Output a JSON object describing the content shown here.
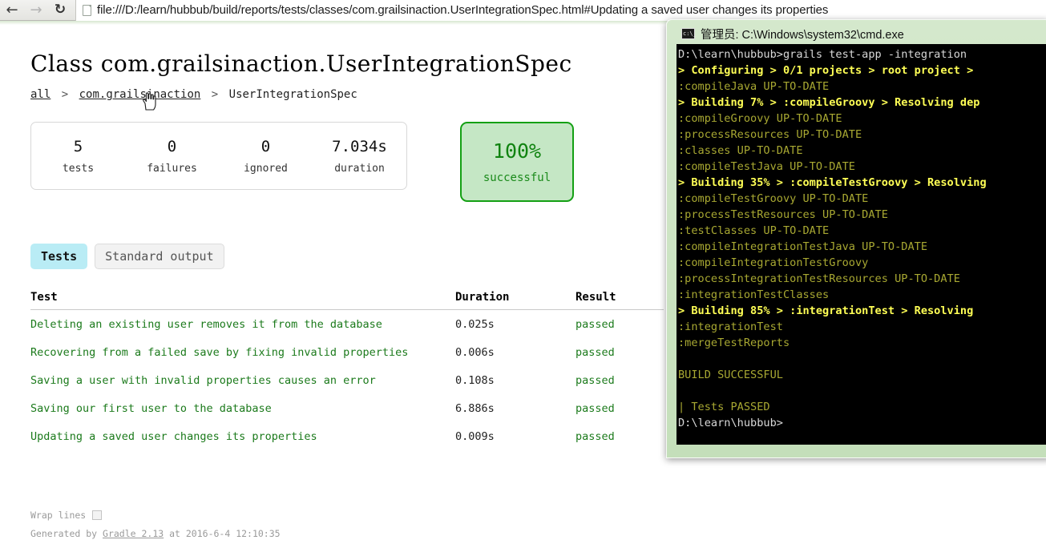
{
  "browser": {
    "back_icon": "back-arrow-icon",
    "forward_icon": "forward-arrow-icon",
    "reload_icon": "reload-icon",
    "page_icon": "page-document-icon",
    "url": "file:///D:/learn/hubbub/build/reports/tests/classes/com.grailsinaction.UserIntegrationSpec.html#Updating a saved user changes its properties"
  },
  "report": {
    "title": "Class com.grailsinaction.UserIntegrationSpec",
    "breadcrumb": {
      "all": "all",
      "package": "com.grailsinaction",
      "current": "UserIntegrationSpec",
      "separator": ">"
    },
    "summary": [
      {
        "value": "5",
        "label": "tests"
      },
      {
        "value": "0",
        "label": "failures"
      },
      {
        "value": "0",
        "label": "ignored"
      },
      {
        "value": "7.034s",
        "label": "duration"
      }
    ],
    "success": {
      "percent": "100%",
      "label": "successful",
      "border_color": "#14a014",
      "bg_color": "#c5e7c5",
      "text_color": "#108310"
    },
    "tabs": [
      {
        "label": "Tests",
        "active": true
      },
      {
        "label": "Standard output",
        "active": false
      }
    ],
    "table": {
      "headers": {
        "test": "Test",
        "duration": "Duration",
        "result": "Result"
      },
      "rows": [
        {
          "test": "Deleting an existing user removes it from the database",
          "duration": "0.025s",
          "result": "passed"
        },
        {
          "test": "Recovering from a failed save by fixing invalid properties",
          "duration": "0.006s",
          "result": "passed"
        },
        {
          "test": "Saving a user with invalid properties causes an error",
          "duration": "0.108s",
          "result": "passed"
        },
        {
          "test": "Saving our first user to the database",
          "duration": "6.886s",
          "result": "passed"
        },
        {
          "test": "Updating a saved user changes its properties",
          "duration": "0.009s",
          "result": "passed"
        }
      ]
    },
    "footer": {
      "wrap_lines": "Wrap lines",
      "generated_prefix": "Generated by ",
      "generator": "Gradle 2.13",
      "generated_suffix": " at 2016-6-4 12:10:35"
    }
  },
  "console": {
    "icon": "cmd-console-icon",
    "title": "管理员: C:\\Windows\\system32\\cmd.exe",
    "lines": [
      {
        "text": "D:\\learn\\hubbub>grails test-app -integration",
        "color": "white"
      },
      {
        "text": "> Configuring > 0/1 projects > root project > ",
        "color": "yellow"
      },
      {
        "text": ":compileJava UP-TO-DATE",
        "color": "olive"
      },
      {
        "text": "> Building 7% > :compileGroovy > Resolving dep",
        "color": "yellow"
      },
      {
        "text": ":compileGroovy UP-TO-DATE",
        "color": "olive"
      },
      {
        "text": ":processResources UP-TO-DATE",
        "color": "olive"
      },
      {
        "text": ":classes UP-TO-DATE",
        "color": "olive"
      },
      {
        "text": ":compileTestJava UP-TO-DATE",
        "color": "olive"
      },
      {
        "text": "> Building 35% > :compileTestGroovy > Resolving",
        "color": "yellow"
      },
      {
        "text": ":compileTestGroovy UP-TO-DATE",
        "color": "olive"
      },
      {
        "text": ":processTestResources UP-TO-DATE",
        "color": "olive"
      },
      {
        "text": ":testClasses UP-TO-DATE",
        "color": "olive"
      },
      {
        "text": ":compileIntegrationTestJava UP-TO-DATE",
        "color": "olive"
      },
      {
        "text": ":compileIntegrationTestGroovy",
        "color": "olive"
      },
      {
        "text": ":processIntegrationTestResources UP-TO-DATE",
        "color": "olive"
      },
      {
        "text": ":integrationTestClasses",
        "color": "olive"
      },
      {
        "text": "> Building 85% > :integrationTest > Resolving ",
        "color": "yellow"
      },
      {
        "text": ":integrationTest",
        "color": "olive"
      },
      {
        "text": ":mergeTestReports",
        "color": "olive"
      },
      {
        "text": "",
        "color": "olive"
      },
      {
        "text": "BUILD SUCCESSFUL",
        "color": "olive"
      },
      {
        "text": "",
        "color": "olive"
      },
      {
        "text": "| Tests PASSED",
        "color": "olive"
      },
      {
        "text": "D:\\learn\\hubbub>",
        "color": "white"
      }
    ]
  }
}
